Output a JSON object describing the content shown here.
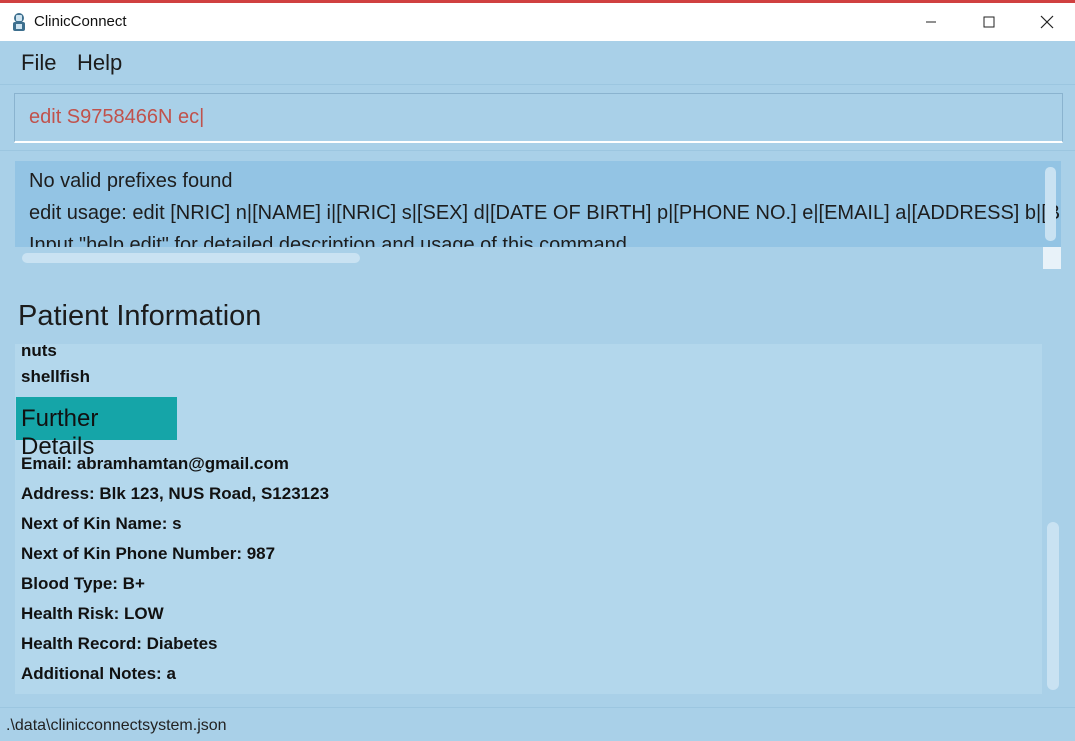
{
  "window": {
    "title": "ClinicConnect",
    "controls": [
      "minimize-icon",
      "maximize-icon",
      "close-icon"
    ]
  },
  "menu": {
    "file_label": "File",
    "help_label": "Help"
  },
  "command_box": {
    "value": "edit S9758466N ec|"
  },
  "result_display": {
    "lines": [
      "No valid prefixes found",
      "edit usage: edit [NRIC] n|[NAME] i|[NRIC] s|[SEX] d|[DATE OF BIRTH] p|[PHONE NO.] e|[EMAIL] a|[ADDRESS] b|[B",
      "Input \"help edit\" for detailed description and usage of this command"
    ]
  },
  "patient_info": {
    "heading": "Patient Information",
    "allergies": [
      "nuts",
      "shellfish"
    ],
    "further_details_label": "Further Details",
    "details": [
      "Email: abramhamtan@gmail.com",
      "Address: Blk 123, NUS Road, S123123",
      "Next of Kin Name: s",
      "Next of Kin Phone Number: 987",
      "Blood Type: B+",
      "Health Risk: LOW",
      "Health Record: Diabetes",
      "Additional Notes: a"
    ]
  },
  "status_bar": {
    "path": ".\\data\\clinicconnectsystem.json"
  },
  "colors": {
    "background": "#a9d0e8",
    "result_box": "#93c4e4",
    "further_details_header": "#15a5a8",
    "command_text": "#c0524c"
  }
}
